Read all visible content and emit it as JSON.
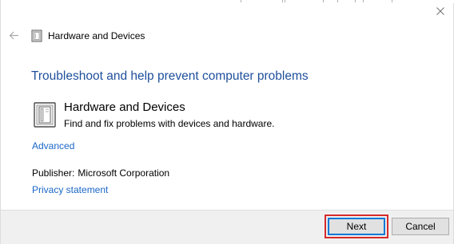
{
  "window": {
    "title": "Hardware and Devices",
    "back_icon": "arrow-left-icon",
    "close_icon": "close-icon"
  },
  "main": {
    "heading": "Troubleshoot and help prevent computer problems",
    "item": {
      "icon": "hardware-devices-icon",
      "title": "Hardware and Devices",
      "description": "Find and fix problems with devices and hardware."
    },
    "advanced_link": "Advanced",
    "publisher_label": "Publisher:",
    "publisher_value": "Microsoft Corporation",
    "privacy_link": "Privacy statement"
  },
  "footer": {
    "next_label": "Next",
    "cancel_label": "Cancel"
  },
  "colors": {
    "heading": "#1e4f9c",
    "link": "#1a66c8",
    "highlight_border": "#d62a2a",
    "focus_border": "#0078d7",
    "footer_bg": "#f0f0f0"
  }
}
